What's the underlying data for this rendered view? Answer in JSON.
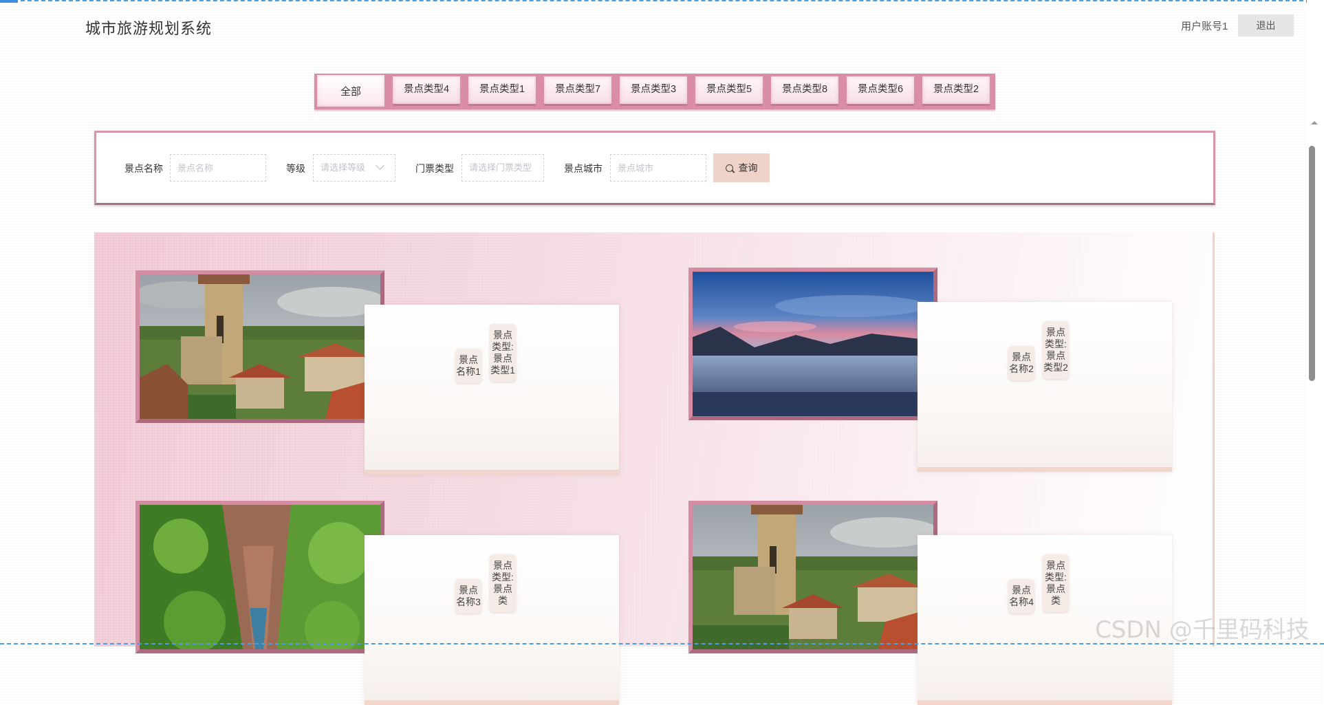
{
  "header": {
    "title": "城市旅游规划系统",
    "user_label": "用户账号1",
    "logout_label": "退出"
  },
  "tabs": [
    {
      "label": "全部",
      "active": true
    },
    {
      "label": "景点类型4",
      "active": false
    },
    {
      "label": "景点类型1",
      "active": false
    },
    {
      "label": "景点类型7",
      "active": false
    },
    {
      "label": "景点类型3",
      "active": false
    },
    {
      "label": "景点类型5",
      "active": false
    },
    {
      "label": "景点类型8",
      "active": false
    },
    {
      "label": "景点类型6",
      "active": false
    },
    {
      "label": "景点类型2",
      "active": false
    }
  ],
  "search": {
    "name_label": "景点名称",
    "name_placeholder": "景点名称",
    "level_label": "等级",
    "level_placeholder": "请选择等级",
    "ticket_label": "门票类型",
    "ticket_placeholder": "请选择门票类型",
    "city_label": "景点城市",
    "city_placeholder": "景点城市",
    "query_label": "查询"
  },
  "cards": [
    {
      "name_text": "景点名称1",
      "type_text": "景点类型:景点类型1",
      "image": "village-church"
    },
    {
      "name_text": "景点名称2",
      "type_text": "景点类型:景点类型2",
      "image": "lake-sunset"
    },
    {
      "name_text": "景点名称3",
      "type_text": "景点类型:景点类",
      "image": "green-canyon"
    },
    {
      "name_text": "景点名称4",
      "type_text": "景点类型:景点类",
      "image": "village-church"
    }
  ],
  "watermark": "CSDN @千里码科技",
  "colors": {
    "tab_bar": "#d98ea5",
    "panel_border": "#d696ab",
    "query_button": "#efd2c8",
    "list_background": "#efc8d3"
  }
}
